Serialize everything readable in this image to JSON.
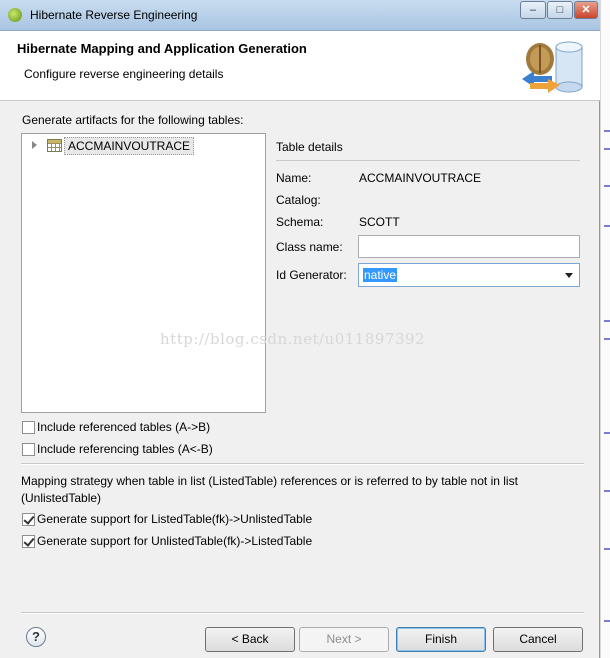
{
  "window": {
    "title": "Hibernate Reverse Engineering"
  },
  "caption_buttons": {
    "minimize": "–",
    "maximize": "□",
    "close": "✕"
  },
  "banner": {
    "title": "Hibernate Mapping and Application Generation",
    "subtitle": "Configure reverse engineering details",
    "graphic_icon": "database-arrows-icon"
  },
  "tables_section": {
    "label": "Generate artifacts for the following tables:",
    "items": [
      {
        "name": "ACCMAINVOUTRACE"
      }
    ]
  },
  "table_details": {
    "heading": "Table details",
    "name_label": "Name:",
    "name_value": "ACCMAINVOUTRACE",
    "catalog_label": "Catalog:",
    "catalog_value": "",
    "schema_label": "Schema:",
    "schema_value": "SCOTT",
    "class_name_label": "Class name:",
    "class_name_value": "",
    "id_generator_label": "Id Generator:",
    "id_generator_value": "native"
  },
  "watermark": "http://blog.csdn.net/u011897392",
  "options": {
    "include_referenced": {
      "label": "Include referenced tables (A->B)",
      "checked": false
    },
    "include_referencing": {
      "label": "Include referencing tables (A<-B)",
      "checked": false
    }
  },
  "mapping": {
    "description": "Mapping strategy when table in list (ListedTable) references or is referred to by table not in list (UnlistedTable)",
    "listed_to_unlisted": {
      "label": "Generate support for ListedTable(fk)->UnlistedTable",
      "checked": true
    },
    "unlisted_to_listed": {
      "label": "Generate support for UnlistedTable(fk)->ListedTable",
      "checked": true
    }
  },
  "buttons": {
    "help": "?",
    "back": "< Back",
    "next": "Next >",
    "finish": "Finish",
    "cancel": "Cancel"
  },
  "colors": {
    "selection": "#3399ff",
    "titlebar": "#b9d1ea"
  }
}
